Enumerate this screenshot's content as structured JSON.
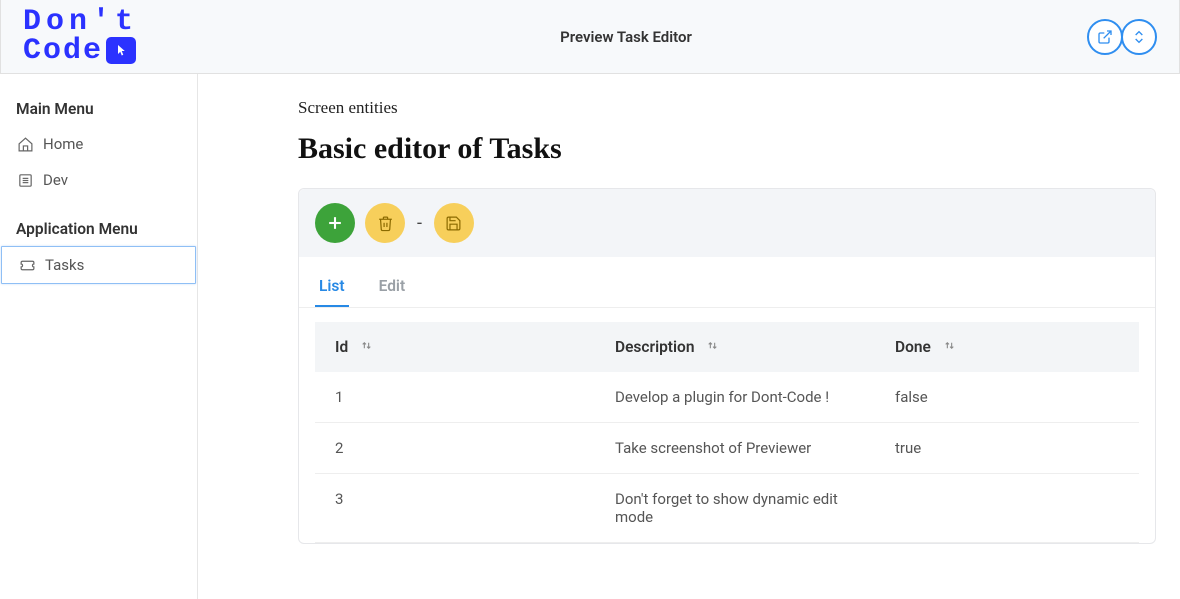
{
  "header": {
    "title": "Preview Task Editor",
    "logo_line1": "Don't",
    "logo_line2": "Code"
  },
  "sidebar": {
    "main_heading": "Main Menu",
    "app_heading": "Application Menu",
    "items_main": [
      {
        "label": "Home"
      },
      {
        "label": "Dev"
      }
    ],
    "items_app": [
      {
        "label": "Tasks"
      }
    ]
  },
  "content": {
    "breadcrumb": "Screen entities",
    "title": "Basic editor of Tasks"
  },
  "tabs": {
    "list": "List",
    "edit": "Edit"
  },
  "table": {
    "columns": {
      "id": "Id",
      "description": "Description",
      "done": "Done"
    },
    "rows": [
      {
        "id": "1",
        "description": "Develop a plugin for Dont-Code !",
        "done": "false"
      },
      {
        "id": "2",
        "description": "Take screenshot of Previewer",
        "done": "true"
      },
      {
        "id": "3",
        "description": "Don't forget to show dynamic edit mode",
        "done": ""
      }
    ]
  }
}
